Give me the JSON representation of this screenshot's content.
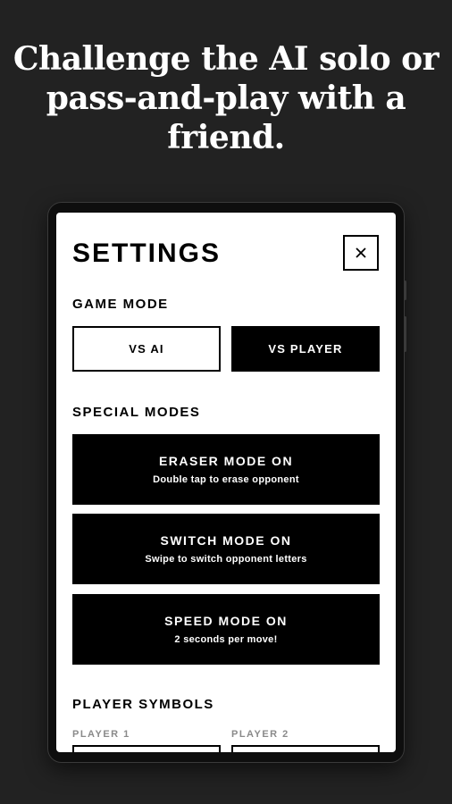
{
  "headline": "Challenge the AI solo or pass-and-play with a friend.",
  "settings": {
    "title": "SETTINGS",
    "close_icon": "close-icon",
    "game_mode": {
      "label": "GAME MODE",
      "options": [
        {
          "label": "VS AI",
          "selected": false
        },
        {
          "label": "VS PLAYER",
          "selected": true
        }
      ]
    },
    "special_modes": {
      "label": "SPECIAL MODES",
      "items": [
        {
          "title": "ERASER MODE ON",
          "subtitle": "Double tap to erase opponent"
        },
        {
          "title": "SWITCH MODE ON",
          "subtitle": "Swipe to switch opponent letters"
        },
        {
          "title": "SPEED MODE ON",
          "subtitle": "2 seconds per move!"
        }
      ]
    },
    "player_symbols": {
      "label": "PLAYER SYMBOLS",
      "players": [
        {
          "label": "PLAYER 1"
        },
        {
          "label": "PLAYER 2"
        }
      ]
    }
  },
  "colors": {
    "background": "#222222",
    "screen": "#ffffff",
    "accent": "#000000",
    "muted_label": "#8a8a8a"
  }
}
